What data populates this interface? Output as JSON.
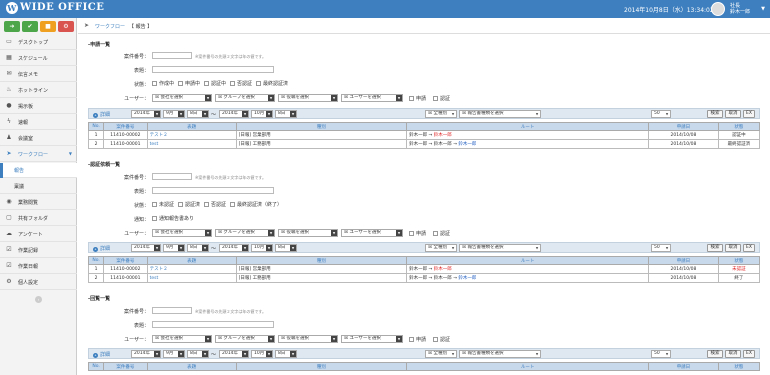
{
  "app": {
    "logo": "WIDE OFFICE",
    "datetime": "2014年10月8日（水）13:34:02",
    "user_role": "社長",
    "user_name": "鈴木一郎"
  },
  "colors": {
    "header": "#3d7fbf",
    "quick": [
      "#4ea64a",
      "#4ea64a",
      "#f0a020",
      "#d9534f"
    ]
  },
  "quick_icons": [
    "arrow-icon",
    "check-icon",
    "folder-icon",
    "gear-icon"
  ],
  "sidebar": [
    {
      "icon": "desktop-icon",
      "label": "デスクトップ"
    },
    {
      "icon": "calendar-icon",
      "label": "スケジュール"
    },
    {
      "icon": "mail-icon",
      "label": "伝言メモ"
    },
    {
      "icon": "hotline-icon",
      "label": "ホットライン"
    },
    {
      "icon": "info-icon",
      "label": "掲示板"
    },
    {
      "icon": "lightning-icon",
      "label": "速報"
    },
    {
      "icon": "people-icon",
      "label": "会議室"
    },
    {
      "icon": "workflow-icon",
      "label": "ワークフロー"
    },
    {
      "icon": "",
      "label": "報告"
    },
    {
      "icon": "",
      "label": "稟議"
    },
    {
      "icon": "globe-icon",
      "label": "業務閲覧"
    },
    {
      "icon": "folder-icon",
      "label": "共有フォルダ"
    },
    {
      "icon": "chat-icon",
      "label": "アンケート"
    },
    {
      "icon": "check-icon",
      "label": "作業記録"
    },
    {
      "icon": "check-icon",
      "label": "作業日報"
    },
    {
      "icon": "gear-icon",
      "label": "個人設定"
    }
  ],
  "breadcrumb": {
    "l1": "ワークフロー",
    "l2": "【 報告 】"
  },
  "form": {
    "case_no": "案件番号：",
    "title": "表題：",
    "status": "状態：",
    "notify": "通知：",
    "user": "ユーザー：",
    "note": "※案件番号の先頭２文字は年の値です。",
    "co": "会社を選択",
    "grp": "グループを選択",
    "pos": "役職を選択",
    "usr": "ユーザーを選択",
    "req": "申請",
    "app": "認証",
    "notify_cb": "通知報告書あり"
  },
  "sections": [
    {
      "title": "申請一覧",
      "statuses": [
        "作成中",
        "申請中",
        "認証中",
        "否認証",
        "最終認証済"
      ]
    },
    {
      "title": "認証依頼一覧",
      "statuses": [
        "未認証",
        "認証済",
        "否認証",
        "最終認証済（終了）"
      ]
    },
    {
      "title": "回覧一覧"
    }
  ],
  "bar": {
    "detail": "詳細",
    "y": "2014年",
    "m1": "9月",
    "d": "8日",
    "tilde": "〜",
    "m2": "10月",
    "all": "全種別",
    "rtype": "報告書種類を選択",
    "count": "50",
    "search": "検索",
    "clear": "取消",
    "ex": "EX"
  },
  "cols": [
    "No.",
    "案件番号",
    "表題",
    "種別",
    "ルート",
    "申請日",
    "状態"
  ],
  "table1": [
    {
      "no": "1",
      "case": "11410-00002",
      "title": "テスト２",
      "type": "[日報] 営業部用",
      "r1": "鈴木一郎",
      "r2": "鈴木一郎",
      "date": "2014/10/08",
      "status": "認証中"
    },
    {
      "no": "2",
      "case": "11410-00001",
      "title": "test",
      "type": "[日報] 工務部用",
      "r1": "鈴木一郎",
      "r2": "鈴木一郎",
      "r3": "鈴木一郎",
      "date": "2014/10/08",
      "status": "最終認証済"
    }
  ],
  "table2": [
    {
      "no": "1",
      "case": "11410-00002",
      "title": "テスト２",
      "type": "[日報] 営業部用",
      "r1": "鈴木一郎",
      "r2": "鈴木一郎",
      "date": "2014/10/08",
      "status": "未認証"
    },
    {
      "no": "2",
      "case": "11410-00001",
      "title": "test",
      "type": "[日報] 工務部用",
      "r1": "鈴木一郎",
      "r2": "鈴木一郎",
      "r3": "鈴木一郎",
      "date": "2014/10/08",
      "status": "終了"
    }
  ],
  "arrow": "→"
}
